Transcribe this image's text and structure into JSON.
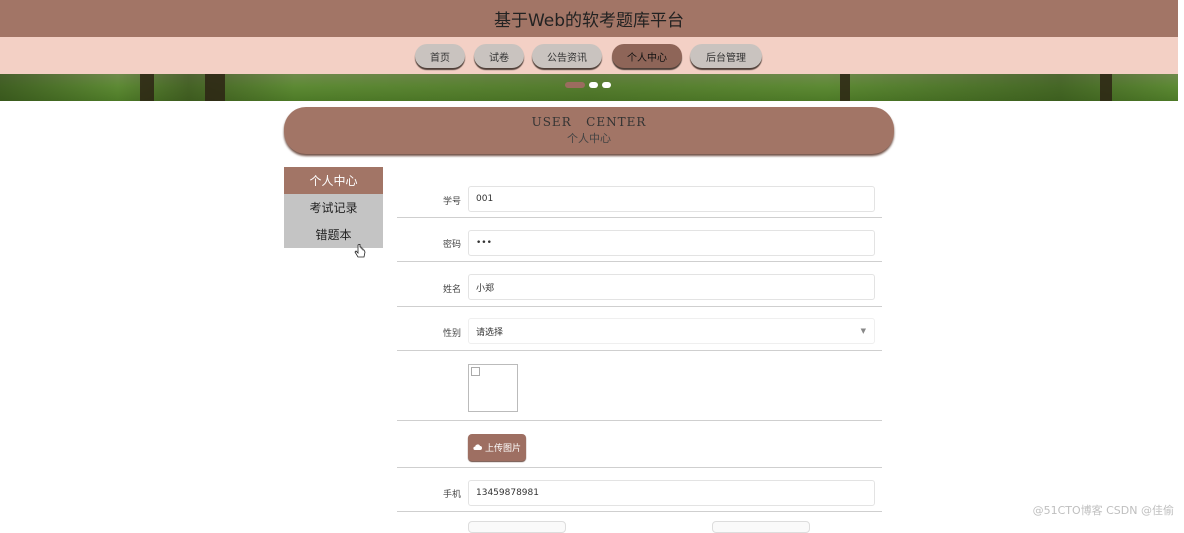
{
  "header": {
    "title": "基于Web的软考题库平台"
  },
  "nav": {
    "items": [
      {
        "label": "首页"
      },
      {
        "label": "试卷"
      },
      {
        "label": "公告资讯"
      },
      {
        "label": "个人中心"
      },
      {
        "label": "后台管理"
      }
    ],
    "active_index": 3
  },
  "section": {
    "title_en": "USER   CENTER",
    "title_cn": "个人中心"
  },
  "sidebar": {
    "items": [
      {
        "label": "个人中心"
      },
      {
        "label": "考试记录"
      },
      {
        "label": "错题本"
      }
    ],
    "active_index": 0
  },
  "form": {
    "account": {
      "label": "学号",
      "value": "001"
    },
    "password": {
      "label": "密码",
      "value": "•••"
    },
    "name": {
      "label": "姓名",
      "value": "小郑"
    },
    "gender": {
      "label": "性别",
      "value": "请选择"
    },
    "upload": {
      "label": "上传图片"
    },
    "phone": {
      "label": "手机",
      "value": "13459878981"
    }
  },
  "watermark": "@51CTO博客   CSDN @佳偷",
  "colors": {
    "primary": "#a27566",
    "nav_bg": "#f3d0c5",
    "side_inactive": "#c4c4c4"
  },
  "icons": [
    "cursor-icon",
    "upload-cloud-icon",
    "broken-image-icon",
    "chevron-down-icon"
  ]
}
